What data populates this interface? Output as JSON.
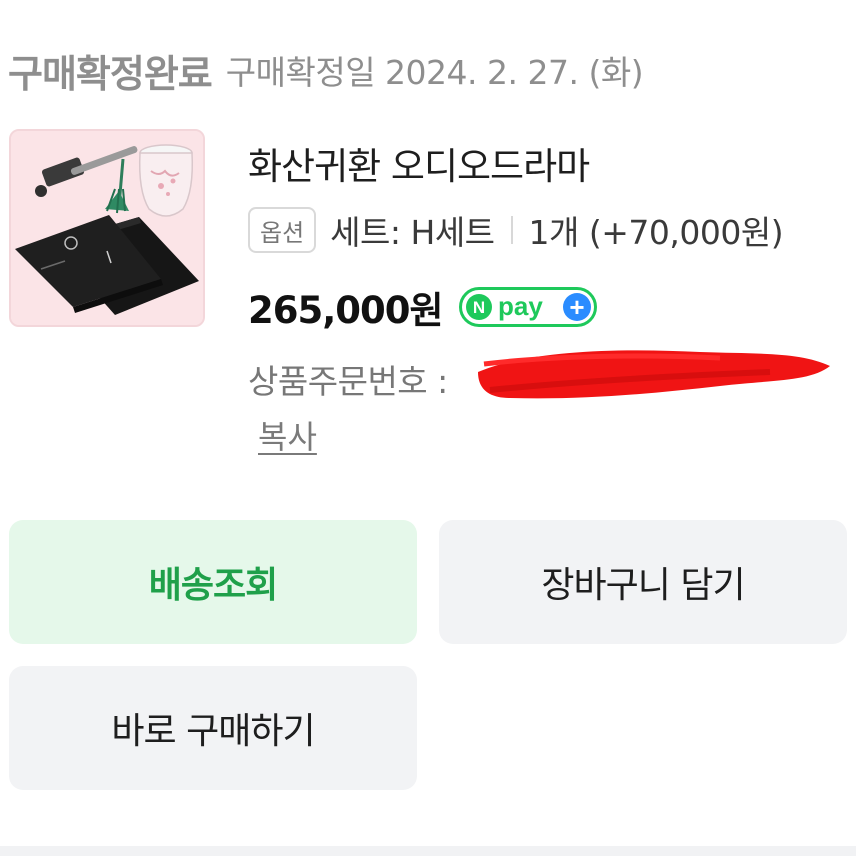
{
  "status": {
    "title": "구매확정완료",
    "date_text": "구매확정일 2024. 2. 27. (화)"
  },
  "product": {
    "name": "화산귀환 오디오드라마",
    "option_badge": "옵션",
    "option_value": "세트: H세트",
    "quantity_text": "1개 (+70,000원)",
    "price": "265,000원",
    "npay_badge": {
      "n": "N",
      "text": "pay",
      "plus": "+"
    },
    "order_number_label": "상품주문번호 :",
    "copy_label": "복사"
  },
  "colors": {
    "npay_green": "#1ec95b",
    "npay_plus_blue": "#2a8cff",
    "redaction_red": "#f01414",
    "track_button_bg": "#e5f8ea",
    "track_button_text": "#1fa04a",
    "neutral_button_bg": "#f2f3f5"
  },
  "buttons": {
    "track_delivery": "배송조회",
    "add_to_cart": "장바구니 담기",
    "buy_now": "바로 구매하기"
  }
}
